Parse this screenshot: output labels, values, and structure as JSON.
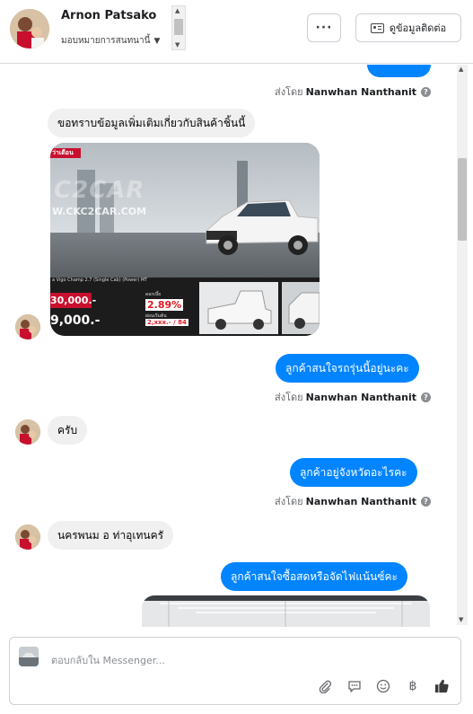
{
  "header": {
    "contact_name": "Arnon Patsako",
    "assign_label": "มอบหมายการสนทนานี้",
    "more_label": "···",
    "contact_info_label": "ดูข้อมูลติดต่อ"
  },
  "messages": [
    {
      "direction": "out",
      "text": "",
      "partial": true
    },
    {
      "sender_prefix": "ส่งโดย",
      "sender_name": "Nanwhan Nanthanit"
    },
    {
      "direction": "in",
      "text": "ขอทราบข้อมูลเพิ่มเติมเกี่ยวกับสินค้าชิ้นนี้"
    },
    {
      "direction": "out",
      "text": "ลูกค้าสนใจรถรุ่นนี้อยู่นะคะ"
    },
    {
      "direction": "in",
      "text": "ครับ"
    },
    {
      "direction": "out",
      "text": "ลูกค้าอยู่จังหวัดอะไรคะ"
    },
    {
      "direction": "in",
      "text": "นครพนม อ ท่าอุเทนครั"
    },
    {
      "direction": "out",
      "text": "ลูกค้าสนใจซื้อสดหรือจัดไฟแน้นซ์คะ"
    }
  ],
  "sent_by": {
    "prefix": "ส่งโดย",
    "name": "Nanwhan Nanthanit"
  },
  "ad": {
    "tag": "ว่าเดือน",
    "logo": "C2CAR",
    "url": "W.CKC2CAR.COM",
    "model": "a Vigo Champ 2.7 (Single Cab) (Power) MT",
    "price_main": "30,000.-",
    "price_down": "9,000.-",
    "rate_label": "ดอกเบี้ย",
    "rate": "2.89%",
    "monthly_label": "ผ่อนเริ่มต้น",
    "monthly": "2,xxx.- / 84"
  },
  "composer": {
    "placeholder": "ตอบกลับใน Messenger..."
  },
  "colors": {
    "outgoing": "#0084ff",
    "incoming": "#f0f0f0",
    "accent_red": "#c8102e"
  },
  "icons": [
    "paperclip-icon",
    "chat-bubble-icon",
    "emoji-icon",
    "baht-icon",
    "thumbs-up-icon",
    "help-icon",
    "card-icon"
  ]
}
